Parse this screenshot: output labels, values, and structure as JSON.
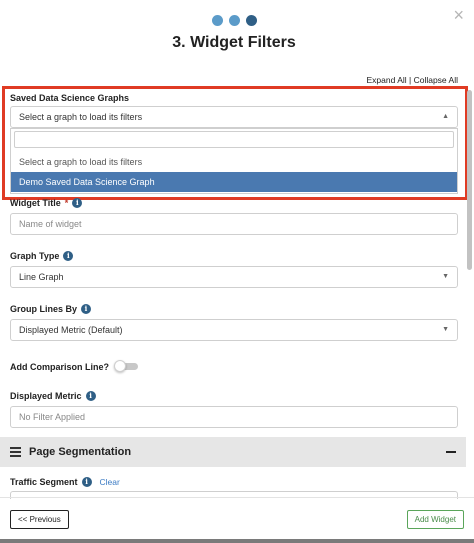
{
  "wizard": {
    "step_title": "3. Widget Filters",
    "steps": [
      {
        "state": "complete"
      },
      {
        "state": "complete"
      },
      {
        "state": "active"
      }
    ]
  },
  "links": {
    "expand_all": "Expand All",
    "separator": " | ",
    "collapse_all": "Collapse All"
  },
  "saved_graphs": {
    "label": "Saved Data Science Graphs",
    "selected": "Select a graph to load its filters",
    "search_value": "",
    "options": [
      {
        "label": "Select a graph to load its filters",
        "highlighted": false
      },
      {
        "label": "Demo Saved Data Science Graph",
        "highlighted": true
      }
    ]
  },
  "widget_title": {
    "label": "Widget Title",
    "required_mark": "*",
    "placeholder": "Name of widget",
    "value": ""
  },
  "graph_type": {
    "label": "Graph Type",
    "value": "Line Graph"
  },
  "group_lines_by": {
    "label": "Group Lines By",
    "value": "Displayed Metric (Default)"
  },
  "comparison_line": {
    "label": "Add Comparison Line?",
    "enabled": false
  },
  "displayed_metric": {
    "label": "Displayed Metric",
    "placeholder": "No Filter Applied",
    "value": ""
  },
  "page_segmentation": {
    "title": "Page Segmentation",
    "toggle_symbol": "−"
  },
  "traffic_segment": {
    "label": "Traffic Segment",
    "clear_label": "Clear"
  },
  "buttons": {
    "previous": "<< Previous",
    "add_widget": "Add Widget"
  },
  "icons": {
    "close": "×",
    "info": "i",
    "caret": "▲",
    "caret_down": "▼"
  },
  "colors": {
    "highlight": "#e03b24",
    "selected_option": "#4a79b0",
    "accent": "#2f5f86",
    "add_button": "#5aa55a"
  }
}
